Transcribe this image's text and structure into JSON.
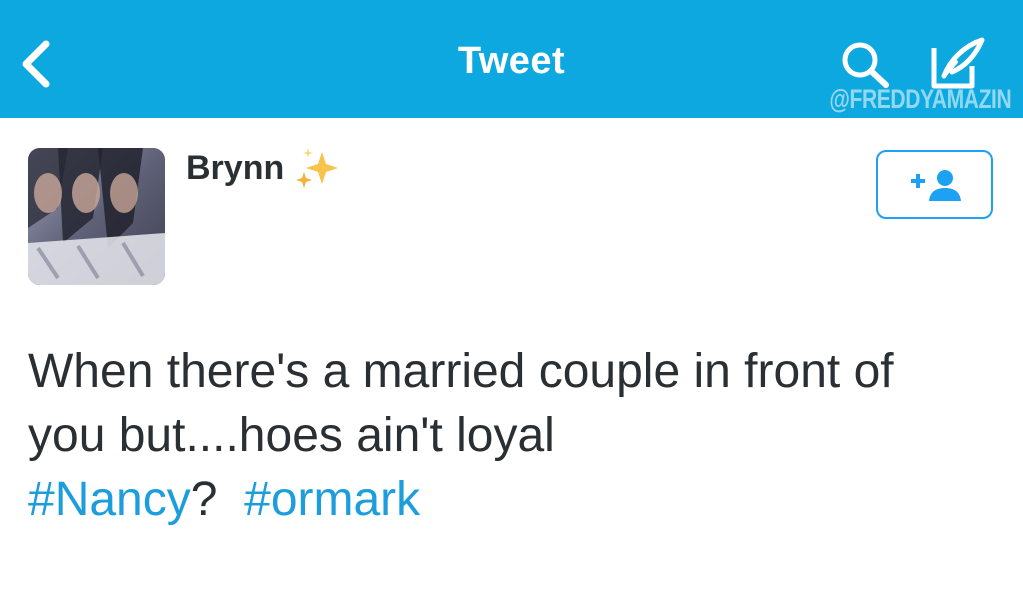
{
  "header": {
    "title": "Tweet",
    "back_icon": "chevron-left-icon",
    "search_icon": "search-icon",
    "compose_icon": "compose-icon",
    "watermark": "@FREDDYAMAZIN",
    "background_color": "#0ea8e0"
  },
  "author": {
    "name": "Brynn",
    "emoji": "sparkles-icon"
  },
  "follow_button": {
    "icon": "add-user-icon",
    "accent_color": "#1da1f2"
  },
  "tweet": {
    "line1": "When there's a married couple in front of",
    "line2": "you but....hoes ain't loyal",
    "hashtag1": "#Nancy",
    "after_hashtag1": "?",
    "hashtag2": "#ormark",
    "hashtag_color": "#1c9ddc"
  }
}
